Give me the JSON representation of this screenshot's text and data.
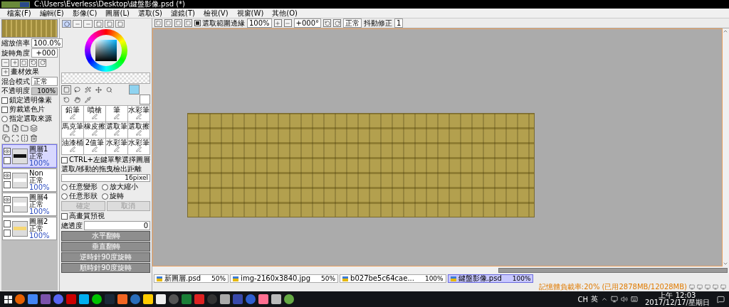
{
  "window": {
    "title": "C:\\Users\\Everless\\Desktop\\鍵盤影像.psd (*)"
  },
  "menu": [
    "檔案(F)",
    "編輯(E)",
    "影像(C)",
    "圖層(L)",
    "選取(S)",
    "濾鏡(T)",
    "檢視(V)",
    "視窗(W)",
    "其他(O)"
  ],
  "navigator": {
    "zoom_label": "縮放倍率",
    "zoom": "100.0%",
    "rotate_label": "旋轉角度",
    "rotate": "+000"
  },
  "layer_props": {
    "effect_label": "畫材效果",
    "blend_label": "混合模式",
    "blend": "正常",
    "opacity_label": "不透明度",
    "opacity": "100%",
    "level": 1,
    "options": [
      {
        "label": "鎖定透明像素",
        "checked": false
      },
      {
        "label": "剪裁遮色片",
        "checked": false
      }
    ],
    "source": {
      "label": "指定選取來源",
      "selected": false
    }
  },
  "layers": [
    {
      "name": "圖層1",
      "mode": "正常",
      "opacity": "100%",
      "selected": true,
      "visible": true,
      "color": "#111111"
    },
    {
      "name": "Non",
      "mode": "正常",
      "opacity": "100%",
      "selected": false,
      "visible": true,
      "color": "#ffffff"
    },
    {
      "name": "圖層4",
      "mode": "正常",
      "opacity": "100%",
      "selected": false,
      "visible": true,
      "color": "#ffffff"
    },
    {
      "name": "圖層2",
      "mode": "正常",
      "opacity": "100%",
      "selected": false,
      "visible": false,
      "color": "#f7d774"
    }
  ],
  "color_modes": [
    {
      "selected": true
    },
    {
      "selected": false
    },
    {
      "selected": false
    },
    {
      "selected": false
    },
    {
      "selected": false
    },
    {
      "selected": false
    }
  ],
  "swatches": [
    {
      "kind": "foreground",
      "color": "#8fd3f0"
    },
    {
      "kind": "background",
      "color": "#ffffff"
    }
  ],
  "brushes": [
    "鉛筆",
    "噴槍",
    "筆",
    "水彩筆",
    "馬克筆",
    "橡皮擦",
    "選取筆",
    "選取擦",
    "油漆桶",
    "2值筆",
    "水彩筆",
    "水彩筆"
  ],
  "tool_options": {
    "ctrl_select": {
      "label": "CTRL+左鍵單擊選擇圖層",
      "checked": false
    },
    "drag_label": "選取/移動的拖曳檢出距離",
    "drag_value": "16pixel",
    "transform_modes": [
      {
        "label": "任意變形",
        "selected": false
      },
      {
        "label": "放大縮小",
        "selected": false
      },
      {
        "label": "任意形狀",
        "selected": false
      },
      {
        "label": "旋轉",
        "selected": false
      }
    ],
    "buttons": [
      {
        "label": "確定",
        "disabled": true
      },
      {
        "label": "取消",
        "disabled": true
      }
    ],
    "hq_preview": {
      "label": "高畫質預視",
      "checked": false
    },
    "density_label": "總透度",
    "density": "0",
    "flip_buttons": [
      "水平翻轉",
      "垂直翻轉",
      "逆時針90度旋轉",
      "順時針90度旋轉"
    ]
  },
  "toolbar": {
    "selection_edge": {
      "label": "選取範圍邊緣",
      "checked": true
    },
    "zoom": "100%",
    "angle": "+000°",
    "blend": "正常",
    "stabilizer_label": "抖動修正",
    "stabilizer": "1"
  },
  "documents": [
    {
      "name": "新圖層.psd",
      "zoom": "50%",
      "selected": false
    },
    {
      "name": "img-2160x3840.jpg",
      "zoom": "50%",
      "selected": false
    },
    {
      "name": "b027be5c64cae...",
      "zoom": "100%",
      "selected": false
    },
    {
      "name": "鍵盤影像.psd",
      "zoom": "100%",
      "selected": true
    }
  ],
  "status_bar": "記憶體負載率:20% (已用2878MB/12028MB)",
  "taskbar": {
    "tray": [
      "CH",
      "英"
    ],
    "time": "上午 12:03",
    "date": "2017/12/17/星期日"
  }
}
